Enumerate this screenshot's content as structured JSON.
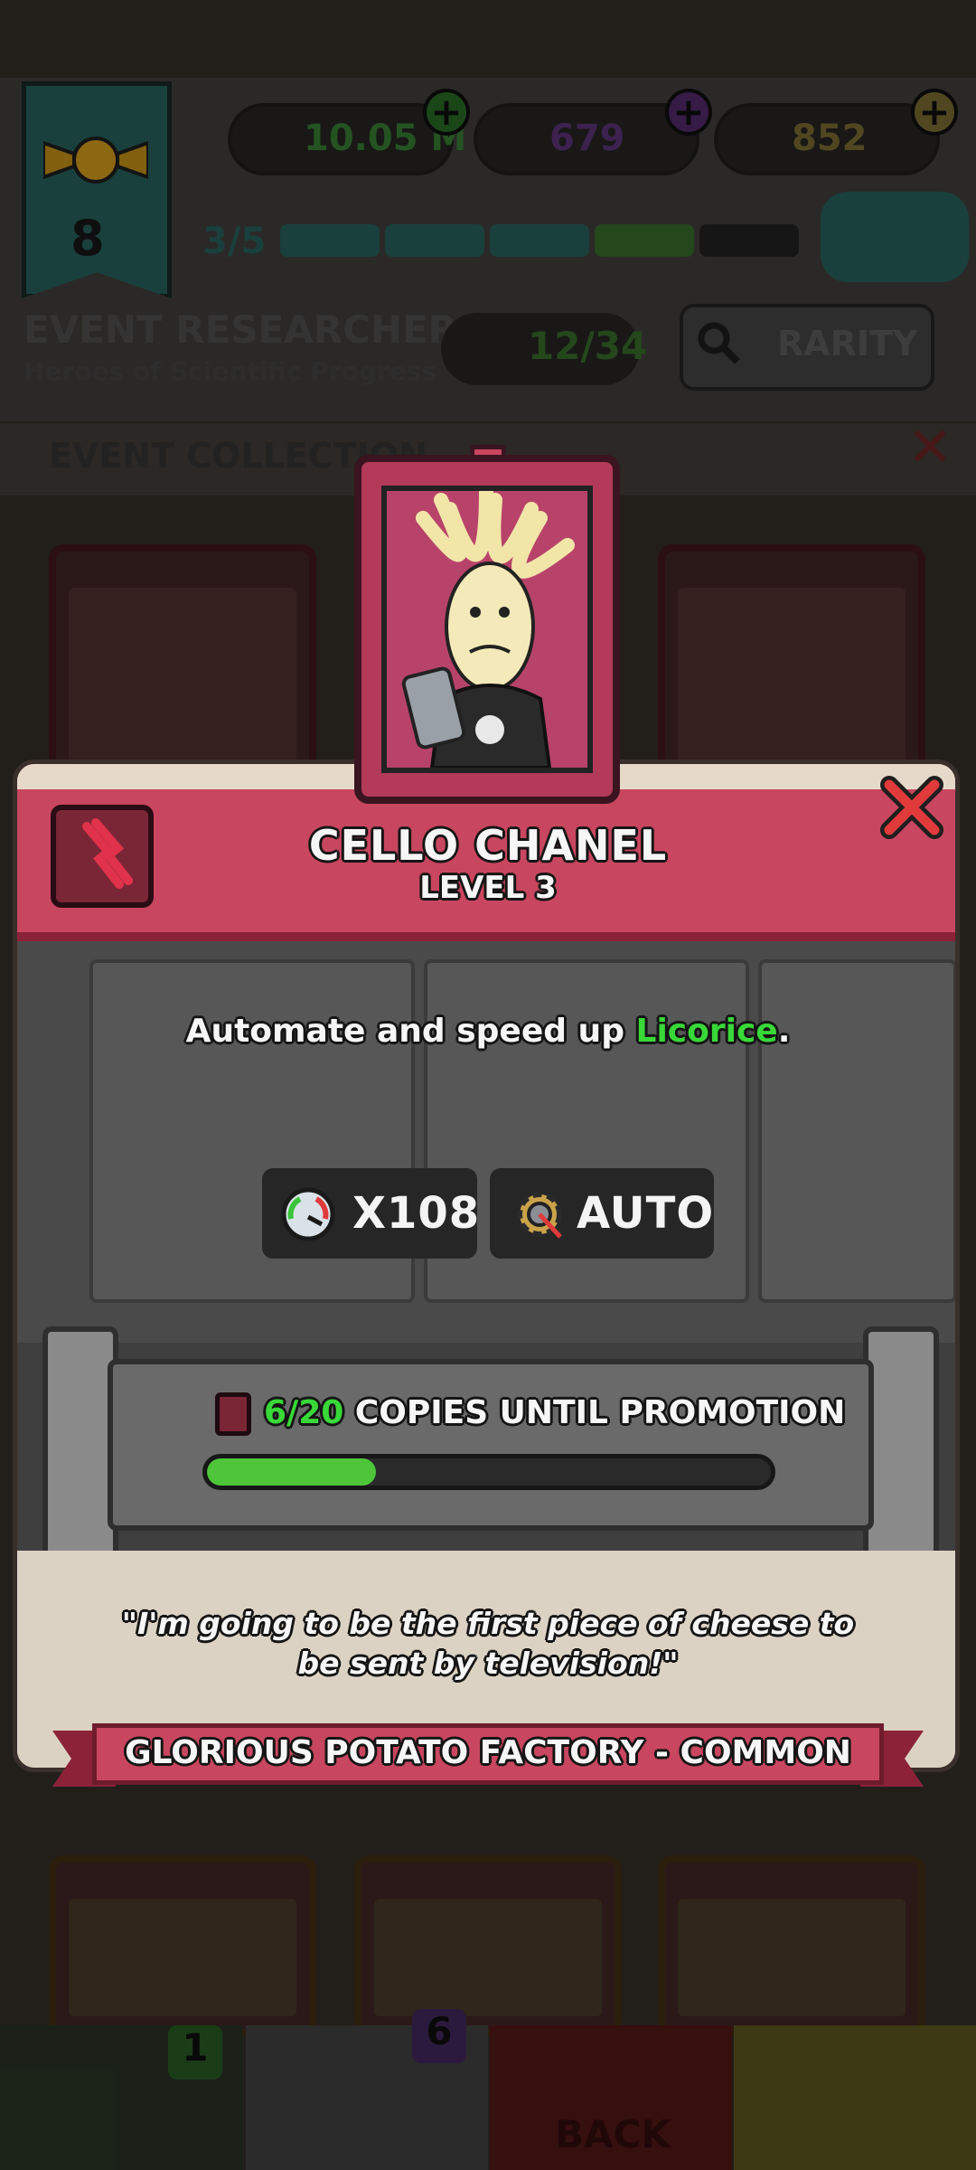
{
  "currencies": [
    {
      "icon": "top-hat-icon",
      "value": "10.05 M",
      "color": "#3f8f3a"
    },
    {
      "icon": "potion-icon",
      "value": "679",
      "color": "#6a3b8a"
    },
    {
      "icon": "gold-bars-icon",
      "value": "852",
      "color": "#8b7a38"
    }
  ],
  "event": {
    "level": "8",
    "progress_text": "3/5",
    "progress_fraction": 0.6,
    "title": "EVENT RESEARCHERS",
    "subtitle": "Heroes of Scientific Progress",
    "collection_count": "12/34",
    "rarity_label": "RARITY",
    "section_label": "EVENT COLLECTION"
  },
  "popup": {
    "name": "CELLO CHANEL",
    "level": "LEVEL 3",
    "description_prefix": "Automate and speed up ",
    "description_highlight": "Licorice",
    "description_suffix": ".",
    "stats": [
      {
        "icon": "speedometer-icon",
        "label": "X108"
      },
      {
        "icon": "gear-icon",
        "label": "AUTO"
      }
    ],
    "copies_count": "6/20",
    "copies_label": " COPIES UNTIL PROMOTION",
    "copies_fraction": 0.3,
    "quote_line1": "\"I'm going to be the first piece of cheese to",
    "quote_line2": "be sent by television!\"",
    "footer_banner": "GLORIOUS POTATO FACTORY - COMMON"
  },
  "bottom_bar": {
    "badge_left": "1",
    "badge_cards": "6",
    "back_label": "BACK"
  },
  "colors": {
    "accent_pink": "#c8465f",
    "highlight_green": "#38d838",
    "progress_green": "#4fc63a"
  }
}
